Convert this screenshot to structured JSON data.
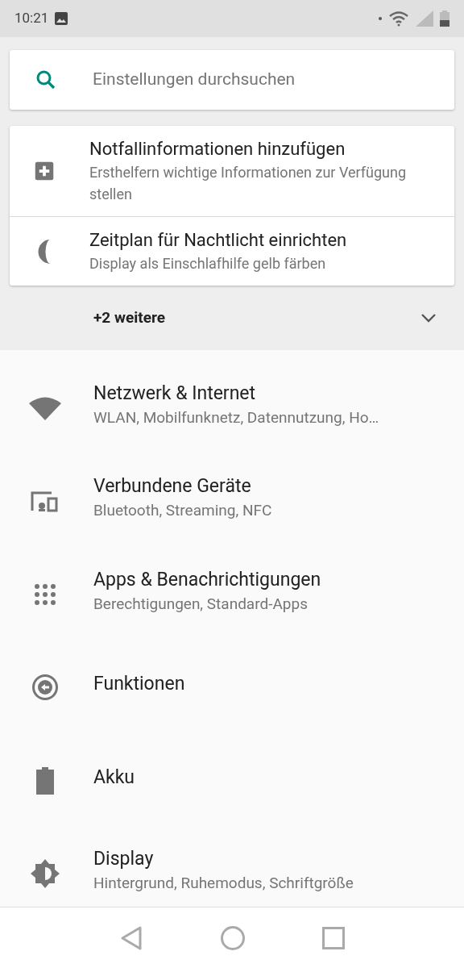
{
  "status_bar": {
    "time": "10:21"
  },
  "search": {
    "placeholder": "Einstellungen durchsuchen"
  },
  "suggestions": [
    {
      "title": "Notfallinformationen hinzufügen",
      "subtitle": "Ersthelfern wichtige Informationen zur Verfügung stellen"
    },
    {
      "title": "Zeitplan für Nachtlicht einrichten",
      "subtitle": "Display als Einschlafhilfe gelb färben"
    }
  ],
  "more": {
    "label": "+2 weitere",
    "expanded": false
  },
  "settings": [
    {
      "title": "Netzwerk & Internet",
      "subtitle": "WLAN, Mobilfunknetz, Datennutzung, Ho…"
    },
    {
      "title": "Verbundene Geräte",
      "subtitle": "Bluetooth, Streaming, NFC"
    },
    {
      "title": "Apps & Benachrichtigungen",
      "subtitle": "Berechtigungen, Standard-Apps"
    },
    {
      "title": "Funktionen"
    },
    {
      "title": "Akku"
    },
    {
      "title": "Display",
      "subtitle": "Hintergrund, Ruhemodus, Schriftgröße"
    }
  ]
}
